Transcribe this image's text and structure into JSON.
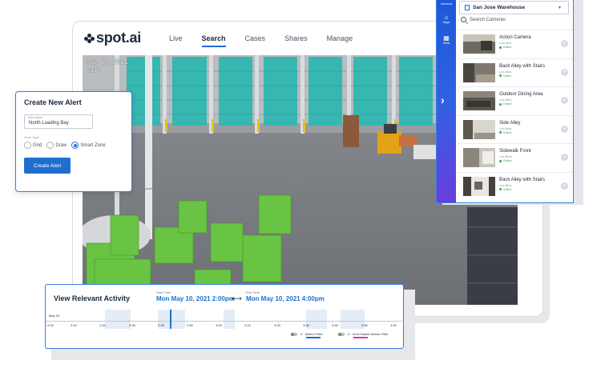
{
  "app": {
    "logo": "spot.ai",
    "nav": [
      {
        "label": "Live",
        "active": false
      },
      {
        "label": "Search",
        "active": true
      },
      {
        "label": "Cases",
        "active": false
      },
      {
        "label": "Shares",
        "active": false
      },
      {
        "label": "Manage",
        "active": false
      }
    ],
    "accent_color": "#1f6fd1"
  },
  "feed": {
    "timestamp_line1": "May 17,2021 ",
    "timestamp_line2": "ra17"
  },
  "alert": {
    "title": "Create New Alert",
    "name_label": "Alert Name",
    "name_value": "North Loading Bay",
    "zone_type_label": "Zone Type",
    "zone_options": [
      "Grid",
      "Draw",
      "Smart Zone"
    ],
    "selected_zone": "Smart Zone",
    "create_button": "Create Alert"
  },
  "cameras": {
    "rail_title": "Cameras",
    "rail_maps": "Maps",
    "rail_walls": "Walls",
    "site": "San Jose Warehouse",
    "search_placeholder": "Search Cameras",
    "status_color": "#2fa84f",
    "list": [
      {
        "name": "Action Camera",
        "location": "Los Altos",
        "status": "Online"
      },
      {
        "name": "Back Alley with Stairs",
        "location": "Los Altos",
        "status": "Online"
      },
      {
        "name": "Outdoor Dining Area",
        "location": "Los Altos",
        "status": "Online"
      },
      {
        "name": "Side Alley",
        "location": "Los Altos",
        "status": "Online"
      },
      {
        "name": "Sidewalk Front",
        "location": "Los Altos",
        "status": "Online"
      },
      {
        "name": "Back Alley with Stairs",
        "location": "Los Altos",
        "status": "Online"
      }
    ]
  },
  "timeline": {
    "title": "View Relevant Activity",
    "start_label": "Start Time",
    "start": "Mon May 10, 2021 2:00pm",
    "end_label": "End Time",
    "end": "Mon May 10, 2021 4:00pm",
    "date": "May 10",
    "ticks": [
      "2:00",
      "2:10",
      "2:20",
      "2:30",
      "2:40",
      "2:50",
      "3:00",
      "3:10",
      "3:20",
      "3:30",
      "3:40",
      "3:50",
      "4:00"
    ],
    "legend": [
      {
        "label": "Motion Filter",
        "state": "off",
        "color": "#1f6fd1"
      },
      {
        "label": "Zone Based Motion Filter",
        "state": "off",
        "color": "#d63aa0"
      }
    ]
  }
}
